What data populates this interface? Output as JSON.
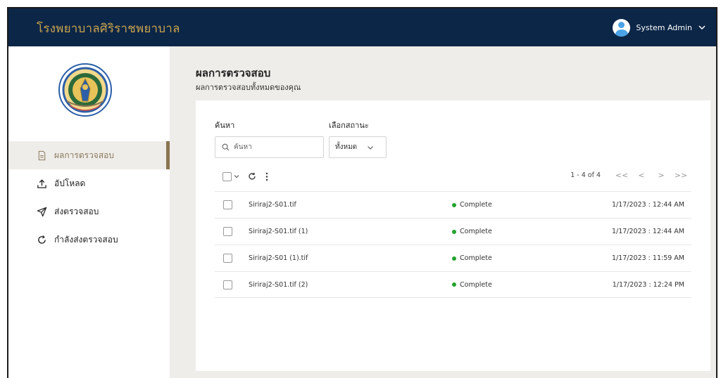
{
  "header": {
    "brand": "โรงพยาบาลศิริราชพยาบาล",
    "user_name": "System Admin"
  },
  "sidebar": {
    "items": [
      {
        "label": "ผลการตรวจสอบ",
        "icon": "document-icon",
        "active": true
      },
      {
        "label": "อัปโหลด",
        "icon": "upload-icon",
        "active": false
      },
      {
        "label": "ส่งตรวจสอบ",
        "icon": "send-icon",
        "active": false
      },
      {
        "label": "กำลังส่งตรวจสอบ",
        "icon": "refresh-icon",
        "active": false
      }
    ]
  },
  "page": {
    "title": "ผลการตรวจสอบ",
    "subtitle": "ผลการตรวจสอบทั้งหมดของคุณ"
  },
  "filters": {
    "search_label": "ค้นหา",
    "search_placeholder": "ค้นหา",
    "status_label": "เลือกสถานะ",
    "status_value": "ทั้งหมด"
  },
  "pager": {
    "range": "1 - 4 of 4",
    "first": "<<",
    "prev": "<",
    "next": ">",
    "last": ">>"
  },
  "rows": [
    {
      "filename": "Siriraj2-S01.tif",
      "status": "Complete",
      "date": "1/17/2023 : 12:44 AM"
    },
    {
      "filename": "Siriraj2-S01.tif (1)",
      "status": "Complete",
      "date": "1/17/2023 : 12:44 AM"
    },
    {
      "filename": "Siriraj2-S01 (1).tif",
      "status": "Complete",
      "date": "1/17/2023 : 11:59 AM"
    },
    {
      "filename": "Siriraj2-S01.tif (2)",
      "status": "Complete",
      "date": "1/17/2023 : 12:24 PM"
    }
  ],
  "colors": {
    "header_bg": "#0c2647",
    "brand_gold": "#c9a34d",
    "active_accent": "#8a7451",
    "status_complete": "#22a32e",
    "page_bg": "#efede9"
  }
}
